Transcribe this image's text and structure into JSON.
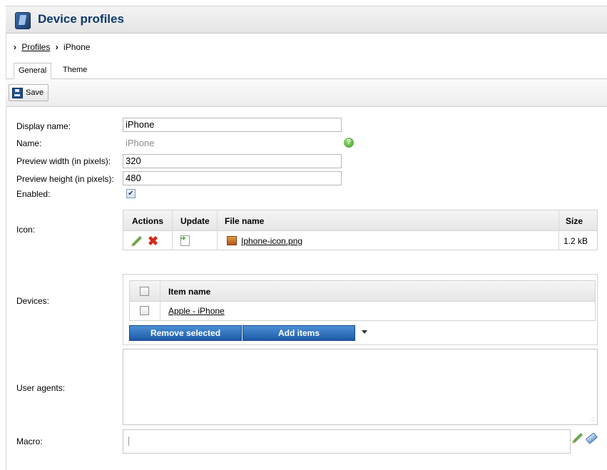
{
  "header": {
    "title": "Device profiles",
    "icon": "device-profile-icon"
  },
  "breadcrumb": {
    "root": "Profiles",
    "current": "iPhone"
  },
  "tabs": [
    {
      "label": "General"
    },
    {
      "label": "Theme"
    }
  ],
  "toolbar": {
    "save_label": "Save"
  },
  "form": {
    "display_name_label": "Display name:",
    "display_name_value": "iPhone",
    "name_label": "Name:",
    "name_value": "iPhone",
    "preview_width_label": "Preview width (in pixels):",
    "preview_width_value": "320",
    "preview_height_label": "Preview height (in pixels):",
    "preview_height_value": "480",
    "enabled_label": "Enabled:",
    "enabled_checked": true,
    "icon_label": "Icon:",
    "devices_label": "Devices:",
    "user_agents_label": "User agents:",
    "macro_label": "Macro:"
  },
  "icon_table": {
    "headers": [
      "Actions",
      "Update",
      "File name",
      "Size"
    ],
    "rows": [
      {
        "file_name": "Iphone-icon.png",
        "size": "1.2 kB"
      }
    ]
  },
  "devices_table": {
    "header": "Item name",
    "rows": [
      {
        "name": "Apple - iPhone"
      }
    ],
    "remove_label": "Remove selected",
    "add_label": "Add items"
  },
  "colors": {
    "title": "#0c3a6d",
    "button_blue": "#1d5aa6",
    "help_green": "#3c9a1f",
    "delete_red": "#d12a1a"
  }
}
